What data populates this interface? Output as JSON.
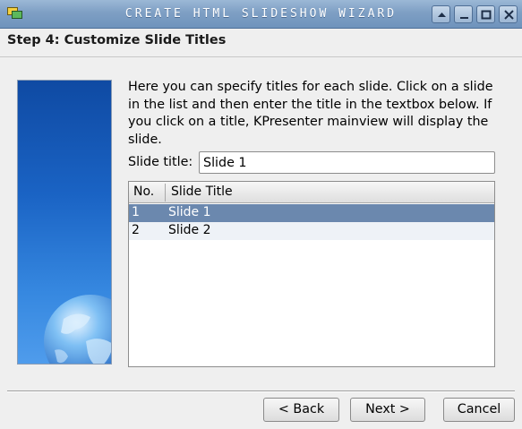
{
  "window": {
    "title": "Create HTML Slideshow Wizard",
    "icon": "kpresenter-app-icon",
    "controls": [
      "shade-icon",
      "minimize-icon",
      "maximize-icon",
      "close-icon"
    ]
  },
  "step": {
    "title": "Step 4: Customize Slide Titles"
  },
  "description": "Here you can specify titles for each slide. Click on a slide in the list and then enter the title in the textbox below. If you click on a title, KPresenter mainview will display the slide.",
  "slide_title": {
    "label": "Slide title:",
    "value": "Slide 1"
  },
  "slide_list": {
    "columns": [
      "No.",
      "Slide Title"
    ],
    "rows": [
      {
        "no": "1",
        "title": "Slide 1",
        "selected": true
      },
      {
        "no": "2",
        "title": "Slide 2",
        "selected": false
      }
    ]
  },
  "buttons": {
    "back": "< Back",
    "next": "Next >",
    "cancel": "Cancel"
  },
  "colors": {
    "titlebar": "#7e9fc4",
    "selection": "#6b88ae",
    "side_panel": "#1a63c4"
  }
}
